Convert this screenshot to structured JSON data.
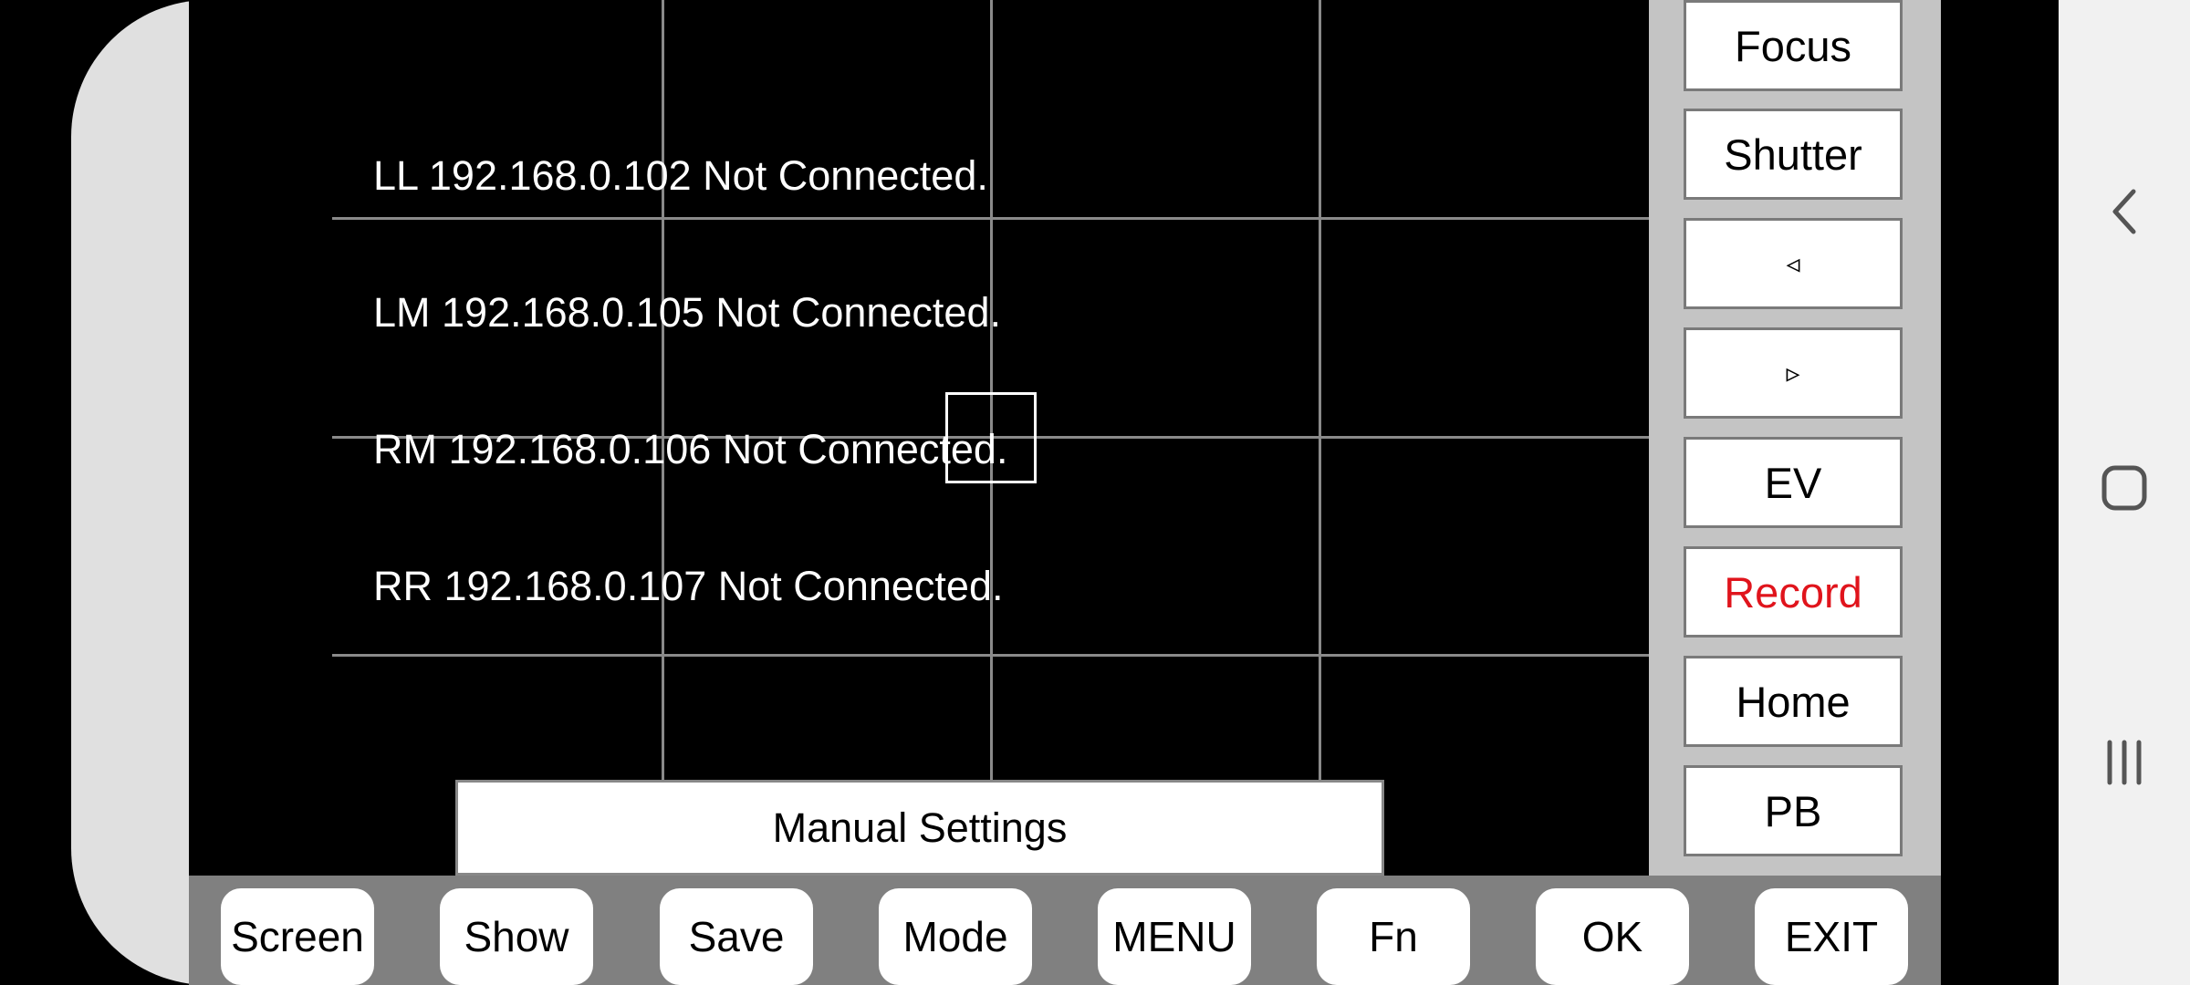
{
  "status_lines": [
    "LL 192.168.0.102 Not Connected.",
    "LM 192.168.0.105 Not Connected.",
    "RM 192.168.0.106 Not Connected.",
    "RR 192.168.0.107 Not Connected."
  ],
  "manual_settings_label": "Manual Settings",
  "side_buttons": {
    "focus": "Focus",
    "shutter": "Shutter",
    "prev": "◃",
    "next": "▹",
    "ev": "EV",
    "record": "Record",
    "home": "Home",
    "pb": "PB"
  },
  "bottom_buttons": {
    "screen": "Screen",
    "show": "Show",
    "save": "Save",
    "mode": "Mode",
    "menu": "MENU",
    "fn": "Fn",
    "ok": "OK",
    "exit": "EXIT"
  },
  "colors": {
    "record_text": "#e0141c",
    "grid_line": "#8a8a8a",
    "side_panel_bg": "#c4c4c4",
    "bottom_bar_bg": "#808080"
  },
  "icons": {
    "nav_back": "chevron-left-icon",
    "nav_home": "home-square-icon",
    "nav_recent": "recent-apps-icon"
  }
}
